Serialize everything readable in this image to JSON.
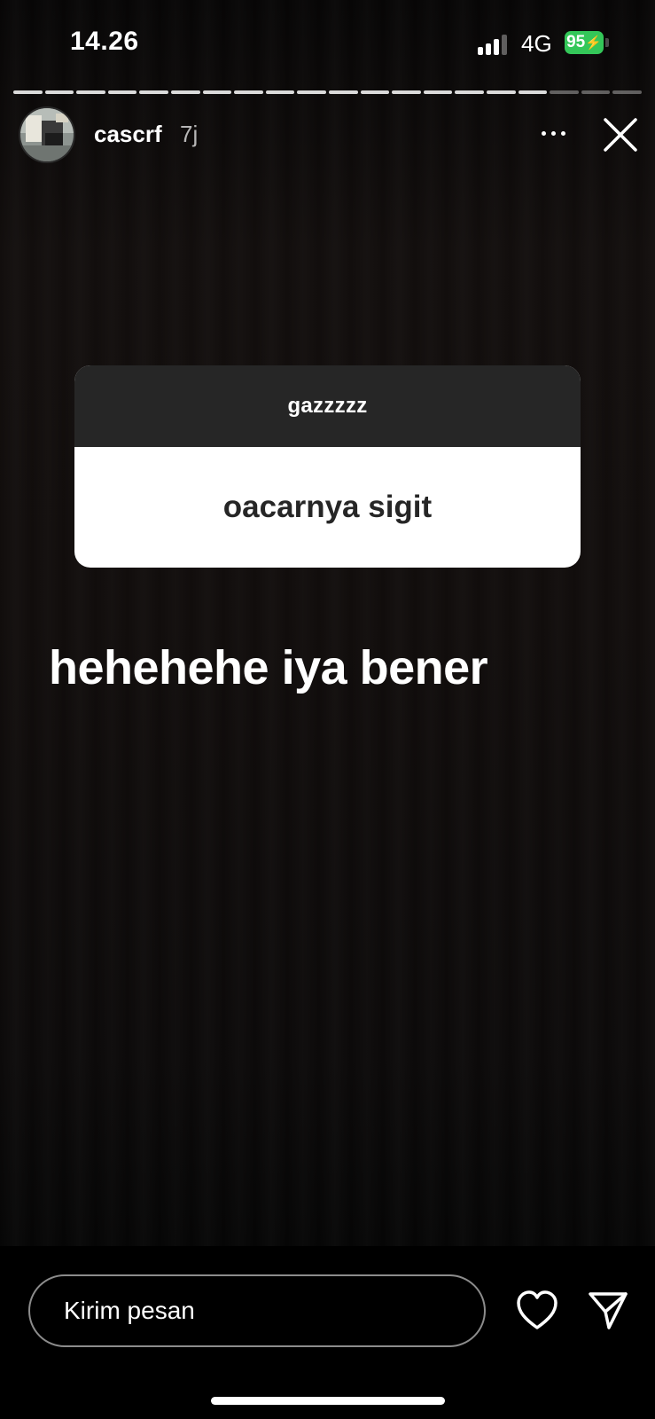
{
  "status_bar": {
    "time": "14.26",
    "network": "4G",
    "battery": "95"
  },
  "story": {
    "username": "cascrf",
    "timestamp": "7j",
    "segments_total": 20,
    "segments_seen": 17
  },
  "question_sticker": {
    "question": "gazzzzz",
    "answer": "oacarnya sigit"
  },
  "story_text": "hehehehe iya bener",
  "reply": {
    "placeholder": "Kirim pesan"
  },
  "icons": {
    "more": "more-dots-icon",
    "close": "close-icon",
    "like": "heart-icon",
    "send": "send-icon"
  },
  "colors": {
    "battery": "#34c759",
    "card_header": "#262626",
    "card_body": "#ffffff"
  }
}
